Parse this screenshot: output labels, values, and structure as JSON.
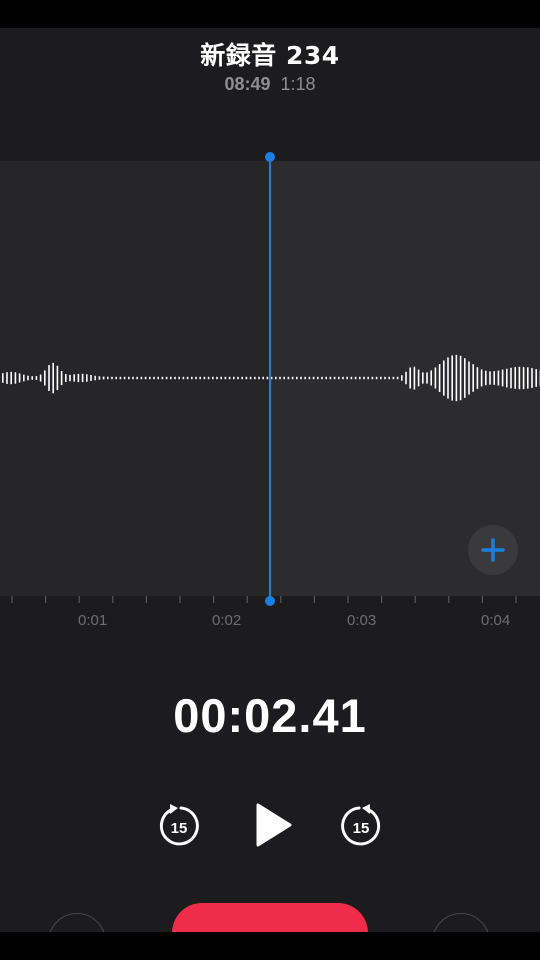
{
  "recording": {
    "title": "新録音 234",
    "recorded_time": "08:49",
    "duration": "1:18",
    "current_position": "00:02.41"
  },
  "timeline": {
    "labels": [
      "0:01",
      "0:02",
      "0:03",
      "0:04"
    ]
  },
  "controls": {
    "skip_back_seconds": "15",
    "skip_forward_seconds": "15"
  },
  "colors": {
    "accent": "#1a7fe0",
    "record": "#ef2c4a",
    "background": "#1c1c1e"
  }
}
